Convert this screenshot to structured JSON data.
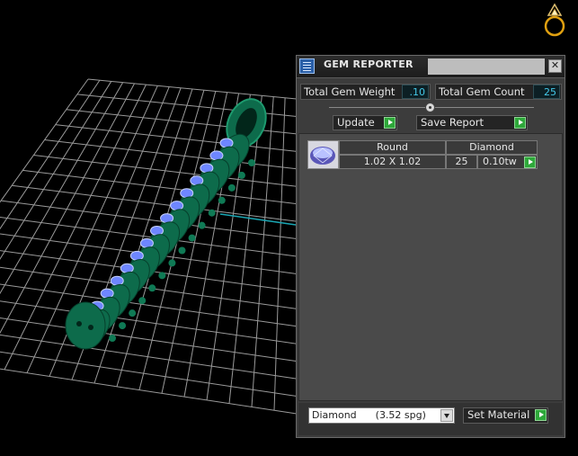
{
  "panel": {
    "title": "GEM REPORTER",
    "close_glyph": "✕",
    "total_weight_label": "Total Gem Weight",
    "total_weight_value": ".10",
    "total_count_label": "Total Gem Count",
    "total_count_value": "25",
    "update_label": "Update",
    "save_report_label": "Save Report",
    "gems": [
      {
        "shape": "Round",
        "material": "Diamond",
        "size": "1.02 X 1.02",
        "count": "25",
        "weight": "0.10tw"
      }
    ],
    "material_select": "Diamond      (3.52 spg)",
    "set_material_label": "Set Material"
  },
  "colors": {
    "model_green": "#0d6b4b",
    "gem_blue": "#6e86ff",
    "grid": "#9a9a9a",
    "axis": "#1aa7b4",
    "value_text": "#44c8e8"
  },
  "icons": {
    "title": "gem-reporter-icon",
    "close": "close-icon",
    "go": "play-arrow-icon",
    "gem": "gem-thumbnail-icon",
    "logo": "ring-logo-icon"
  }
}
